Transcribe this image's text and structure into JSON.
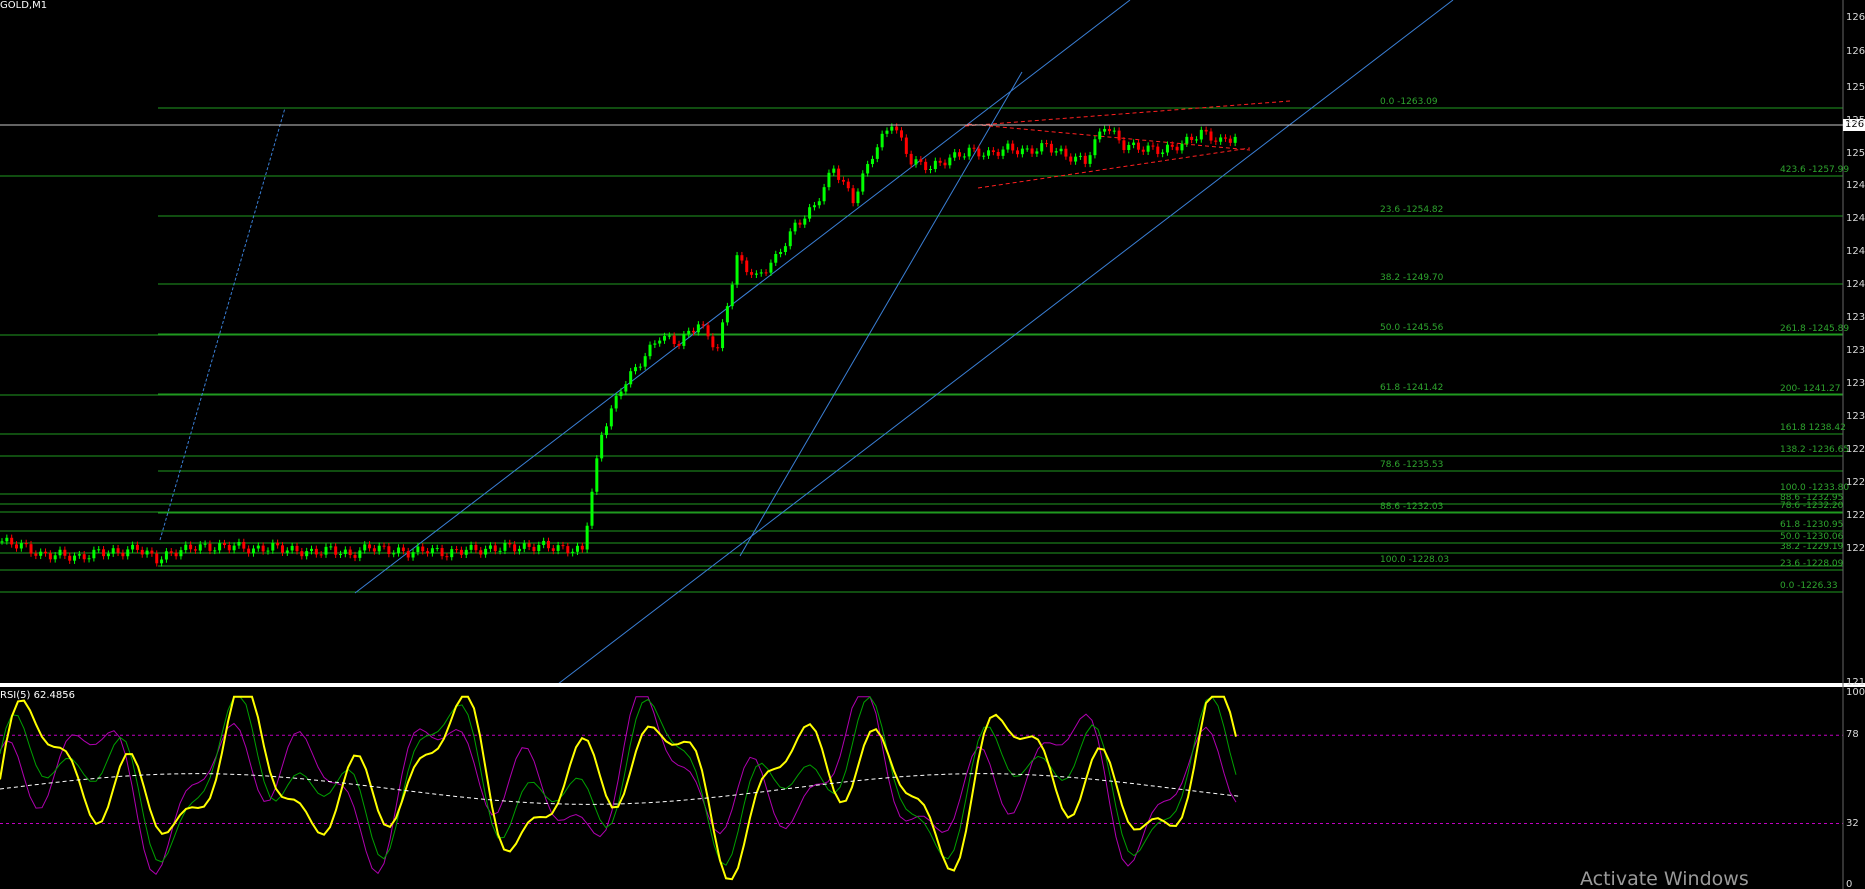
{
  "window": {
    "title": "GOLD,M1",
    "current_price": "126",
    "watermark": "Activate Windows"
  },
  "colors": {
    "background": "#000000",
    "bull_candle": "#00ff00",
    "bear_candle": "#ff0000",
    "fib_lines": "#1f9a1f",
    "fib_text": "#2ea52e",
    "channel_lines": "#3a7fd5",
    "triangle_lines": "#ff2020",
    "rsi_main": "#ffff00",
    "rsi_green": "#00a000",
    "rsi_purple": "#b000b0",
    "rsi_levels": "#c000c0",
    "current_price_line": "#c8c8c8",
    "separator": "#ffffff"
  },
  "price_axis": {
    "labels": [
      "126",
      "126",
      "125",
      "125",
      "125",
      "124",
      "124",
      "124",
      "124",
      "123",
      "123",
      "123",
      "123",
      "122",
      "122",
      "122",
      "122",
      "121"
    ]
  },
  "fibonacci_left": [
    {
      "label": "0.0 -1263.09"
    },
    {
      "label": "23.6 -1254.82"
    },
    {
      "label": "38.2 -1249.70"
    },
    {
      "label": "50.0 -1245.56"
    },
    {
      "label": "61.8 -1241.42"
    },
    {
      "label": "78.6 -1235.53"
    },
    {
      "label": "88.6 -1232.03"
    },
    {
      "label": "100.0 -1228.03"
    }
  ],
  "fibonacci_right": [
    {
      "label": "423.6 -1257.99"
    },
    {
      "label": "261.8 -1245.89"
    },
    {
      "label": "200- 1241.27"
    },
    {
      "label": "161.8 1238.42"
    },
    {
      "label": "138.2 -1236.65"
    },
    {
      "label": "100.0 -1233.80"
    },
    {
      "label": "88.6 -1232.95"
    },
    {
      "label": "78.6 -1232.20"
    },
    {
      "label": "61.8 -1230.95"
    },
    {
      "label": "50.0 -1230.06"
    },
    {
      "label": "38.2 -1229.19"
    },
    {
      "label": "23.6 -1228.09"
    },
    {
      "label": "0.0 -1226.33"
    }
  ],
  "indicator": {
    "label": "RSI(5) 62.4856",
    "axis_labels": [
      "100",
      "78",
      "32",
      "0"
    ],
    "upper_level": 78,
    "lower_level": 32
  },
  "chart_data": {
    "type": "line",
    "symbol": "GOLD",
    "timeframe": "M1",
    "price_series": {
      "name": "GOLD",
      "close": [
        1229.7,
        1229.4,
        1228.6,
        1228.7,
        1228.4,
        1228.9,
        1228.8,
        1229.2,
        1228.3,
        1228.9,
        1229.3,
        1229.2,
        1229.4,
        1229.0,
        1229.3,
        1229.0,
        1228.8,
        1229.1,
        1228.6,
        1229.3,
        1229.0,
        1228.8,
        1229.1,
        1228.7,
        1229.1,
        1229.0,
        1229.3,
        1229.2,
        1229.4,
        1229.1,
        1229.0,
        1238.0,
        1241.5,
        1243.5,
        1245.5,
        1245.0,
        1246.5,
        1244.5,
        1251.5,
        1250.0,
        1251.5,
        1254.0,
        1255.5,
        1258.5,
        1256.0,
        1259.5,
        1262.0,
        1259.0,
        1258.5,
        1259.2,
        1259.8,
        1259.5,
        1260.0,
        1259.7,
        1260.2,
        1259.4,
        1259.0,
        1261.8,
        1260.2,
        1260.0,
        1259.8,
        1260.3,
        1261.2,
        1260.5,
        1261.0
      ]
    },
    "rsi_series": {
      "name": "RSI(5)",
      "last_value": 62.4856,
      "levels": [
        78,
        32
      ],
      "ylim": [
        0,
        100
      ]
    }
  }
}
